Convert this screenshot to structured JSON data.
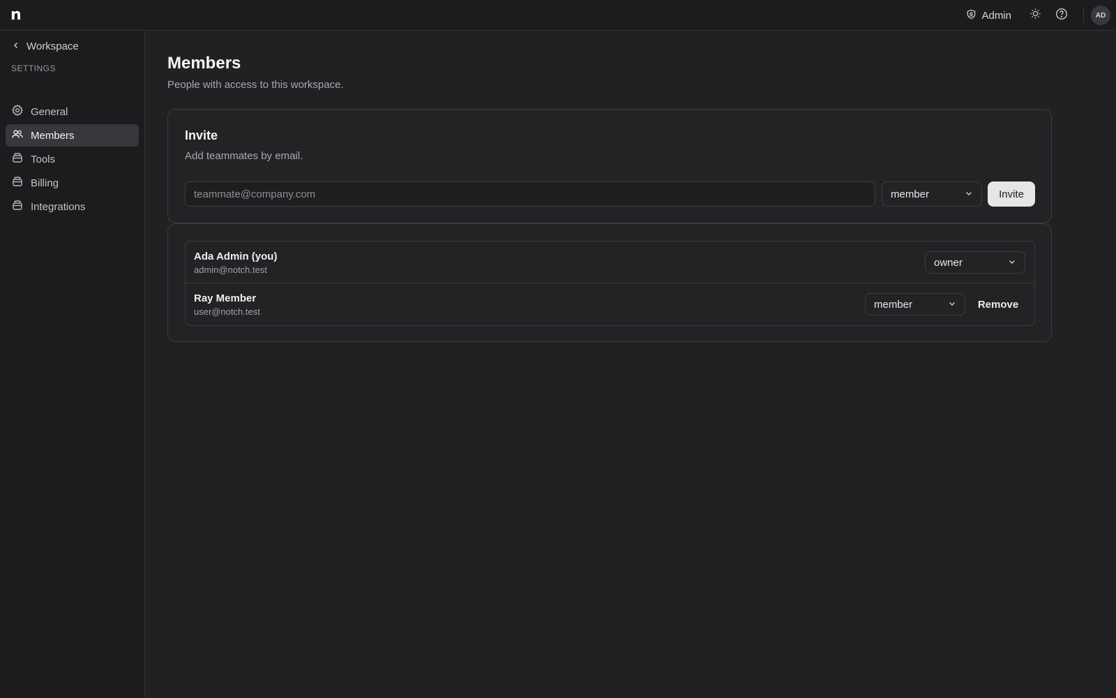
{
  "app": {
    "logo": "n"
  },
  "topbar": {
    "role_label": "Admin",
    "avatar_initials": "AD"
  },
  "sidebar": {
    "back_label": "Workspace",
    "section_label": "SETTINGS",
    "items": [
      {
        "label": "General",
        "icon": "gear-icon",
        "active": false
      },
      {
        "label": "Members",
        "icon": "users-icon",
        "active": true
      },
      {
        "label": "Tools",
        "icon": "box-icon",
        "active": false
      },
      {
        "label": "Billing",
        "icon": "box-icon",
        "active": false
      },
      {
        "label": "Integrations",
        "icon": "box-icon",
        "active": false
      }
    ]
  },
  "page": {
    "title": "Members",
    "subtitle": "People with access to this workspace."
  },
  "invite": {
    "title": "Invite",
    "subtitle": "Add teammates by email.",
    "email_placeholder": "teammate@company.com",
    "email_value": "",
    "role_value": "member",
    "button_label": "Invite"
  },
  "members": [
    {
      "name": "Ada Admin (you)",
      "email": "admin@notch.test",
      "role": "owner"
    },
    {
      "name": "Ray Member",
      "email": "user@notch.test",
      "role": "member",
      "remove_label": "Remove"
    }
  ],
  "colors": {
    "background": "#212123",
    "sidebar": "#1c1c1e",
    "active_item": "#38383c",
    "primary_button": "#e6e6e9"
  }
}
